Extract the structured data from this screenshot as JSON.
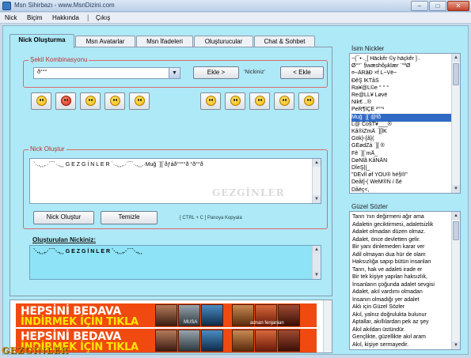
{
  "window": {
    "title": "Msn Sihirbazı - www.MsnDizini.com",
    "minimize_glyph": "–",
    "maximize_glyph": "□",
    "close_glyph": "✕"
  },
  "menu": {
    "items": [
      "Nick",
      "Biçim",
      "Hakkında",
      "|",
      "Çıkış"
    ]
  },
  "tabs": [
    {
      "label": "Nick Oluşturma",
      "active": true
    },
    {
      "label": "Msn Avatarlar",
      "active": false
    },
    {
      "label": "Msn İfadeleri",
      "active": false
    },
    {
      "label": "Oluşturucular",
      "active": false
    },
    {
      "label": "Chat & Sohbet",
      "active": false
    }
  ],
  "shape_section": {
    "legend": "Şekil Kombinasyonu",
    "selected_value": "ð°°°",
    "add_left_label": "Ekle >",
    "middle_text": "'Nickiniz'",
    "add_right_label": "< Ekle",
    "emoticon_icons": [
      "smile-icon",
      "angry-icon",
      "kiss-icon",
      "thinking-icon",
      "cool-icon",
      "confused-icon",
      "grin-icon",
      "embarrassed-icon",
      "sad-icon",
      "wink-icon"
    ]
  },
  "create_section": {
    "legend": "Nick Oluştur",
    "text": "`·.,¸¸,.·´¯`·.,¸¸ G E Z G İ N L E R `·.,¸¸,.·´¯`·.,¸¸.·Muğ ˙][`ðƒáð°°°°ð °ð°°ð",
    "watermark": "GEZGİNLER",
    "create_button": "Nick Oluştur",
    "clear_button": "Temizle",
    "copy_hint": "[ CTRL + C ] Panoya Kopyala"
  },
  "result": {
    "label": "Oluşturulan Nickiniz:",
    "text": "`·.,¸¸,.·´¯`·.,¸¸  G E Z G İ N L E R  `·.,¸¸,.·´¯`·.,¸¸"
  },
  "ad": {
    "line1": "HEPSİNİ BEDAVA",
    "line2": "İNDİRMEK İÇİN TIKLA",
    "caption_musa": "MUSA",
    "caption_other": "adnan fenjanian"
  },
  "brand_logo_text": "GEZGİNLER",
  "right_panel": {
    "nicks_title": "İsim Nickler",
    "nicks": [
      "~(¯•·.¸[ Häckêr ©y häçkêr ]·.",
      "Ø°°¨ §wæshôµklær ¨°ºØ",
      "¤~ÂRâÐ ×f L~Vë~",
      "ÐêŞ lKTåŠ",
      "Ra¥@L©e ° ° ° ",
      "Re@LL¥ Løvë",
      "Nik€ ..®",
      "PeR¶ÌÇE ²°°¹",
      "Muğ ˙][`@fð",
      "L@ Co§T¥___®",
      "Kå®iZmÂ ˙][ÎK",
      "Gök}-{â}(",
      "GÉødZá ˙][ ®",
      "Fê ˙][`mÃ_",
      "DøNlâ KåNÂN",
      "DÎeŞ||_",
      "\"DÉvÎl øf YÖU® hé§®\"",
      "Deåt]-( WeM®N / ßé",
      "Dåëç<,"
    ],
    "selected_nick_index": 8,
    "quotes_title": "Güzel Sözler",
    "quotes": [
      "Tanrı 'nın değirmeni ağır ama",
      "Adaletin geciktirmesi, adaletsizlik",
      "Adalet olmadan düzen olmaz.",
      "Adalet, önce devletten gelir.",
      "Bir yanı dinlemeden karar ver",
      "Adil olmayan dua hür de olam",
      "Haksızlığa sapıp bütün insanları",
      "Tanrı, hak ve adaleti irade er",
      "Bir tek kişiye yapılan haksızlık,",
      "İnsanların çoğunda adalet sevgisi",
      "Adalet, akıl vardımı olmadan",
      "İnsanın olmadığı yer adalet",
      "Aklı için Güzel Sözler",
      "Akıl, yalnız doğrulukta bulunur",
      "Aptallar, akıllılardan pek az şey",
      "Akıl akıldan üstündür.",
      "Gençlikte, güzellikte akıl aram",
      "Akıl, kişiye sermayedir."
    ]
  }
}
